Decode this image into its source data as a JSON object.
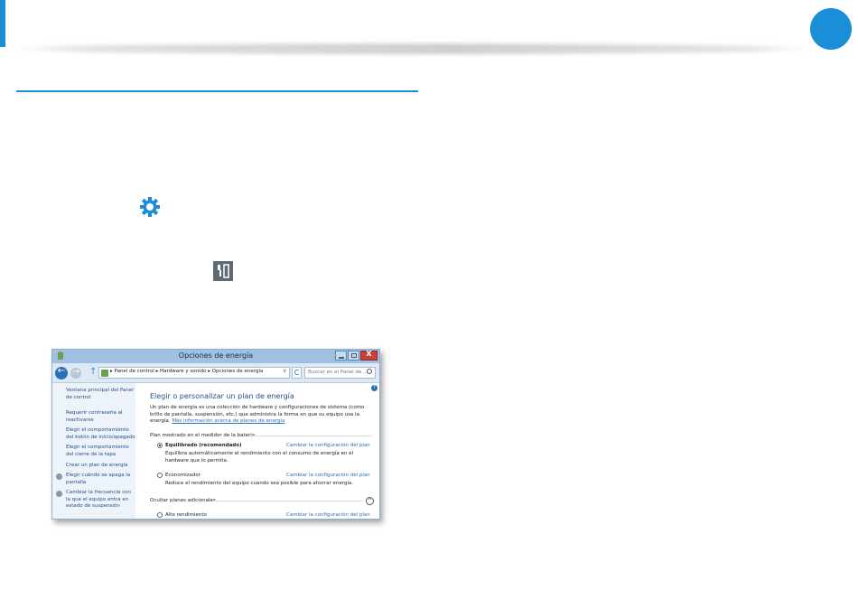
{
  "colors": {
    "accent": "#1a8fd8",
    "link": "#2c6fb8",
    "titlebar": "#9ec1e3",
    "close": "#c7413a"
  },
  "icons": {
    "settings": "gear-icon",
    "power": "power-plug-icon"
  },
  "window": {
    "title": "Opciones de energía",
    "close_label": "X",
    "nav": {
      "back_glyph": "←",
      "forward_glyph": "→",
      "up_glyph": "↑",
      "breadcrumb": "▸ Panel de control ▸ Hardware y sonido ▸ Opciones de energía",
      "dropdown_glyph": "v",
      "refresh_glyph": "C",
      "search_placeholder": "Buscar en el Panel de ..."
    },
    "sidebar": {
      "items": [
        "Ventana principal del Panel de control",
        "Requerir contraseña al reactivarse",
        "Elegir el comportamiento del botón de inicio/apagado",
        "Elegir el comportamiento del cierre de la tapa",
        "Crear un plan de energía",
        "Elegir cuándo se apaga la pantalla",
        "Cambiar la frecuencia con la que el equipo entra en estado de suspensión"
      ]
    },
    "main": {
      "help_glyph": "?",
      "title": "Elegir o personalizar un plan de energía",
      "description": "Un plan de energía es una colección de hardware y configuraciones de sistema (como brillo de pantalla, suspensión, etc.) que administra la forma en que su equipo usa la energía.",
      "more_info_link": "Más información acerca de planes de energía",
      "group_battery": "Plan mostrado en el medidor de la batería",
      "plans": [
        {
          "name": "Equilibrado (recomendado)",
          "link": "Cambiar la configuración del plan",
          "description": "Equilibra automáticamente el rendimiento con el consumo de energía en el hardware que lo permita."
        },
        {
          "name": "Economizador",
          "link": "Cambiar la configuración del plan",
          "description": "Reduce el rendimiento del equipo cuando sea posible para ahorrar energía."
        }
      ],
      "group_hidden": "Ocultar planes adicionales",
      "collapse_glyph": "^",
      "extra_plan": {
        "name": "Alto rendimiento",
        "link": "Cambiar la configuración del plan"
      }
    }
  }
}
